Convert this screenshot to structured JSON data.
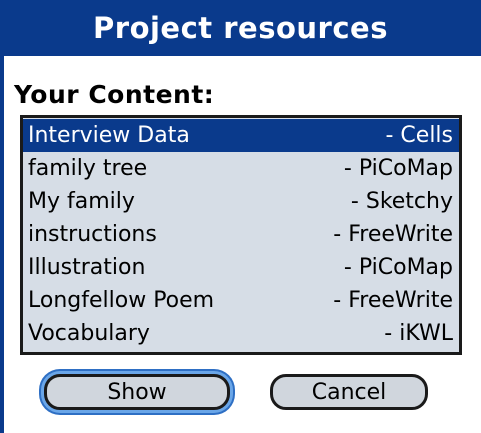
{
  "dialog": {
    "title": "Project resources",
    "section_label": "Your Content:",
    "items": [
      {
        "name": "Interview Data",
        "type": "- Cells",
        "selected": true
      },
      {
        "name": "family tree",
        "type": "- PiCoMap",
        "selected": false
      },
      {
        "name": "My family",
        "type": "- Sketchy",
        "selected": false
      },
      {
        "name": "instructions",
        "type": "- FreeWrite",
        "selected": false
      },
      {
        "name": "Illustration",
        "type": "- PiCoMap",
        "selected": false
      },
      {
        "name": "Longfellow Poem",
        "type": "- FreeWrite",
        "selected": false
      },
      {
        "name": "Vocabulary",
        "type": "- iKWL",
        "selected": false
      }
    ],
    "buttons": {
      "show_label": "Show",
      "cancel_label": "Cancel"
    }
  },
  "colors": {
    "accent": "#0a3a8c",
    "list_background": "#d6dde6",
    "button_background": "#d0d6dd",
    "focus_ring": "#6aa6e8"
  }
}
